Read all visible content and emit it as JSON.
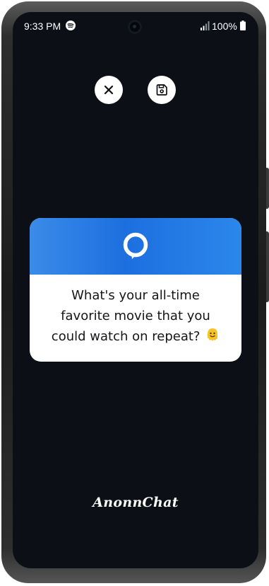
{
  "status_bar": {
    "time": "9:33 PM",
    "battery": "100%",
    "music_app_icon": "spotify-icon",
    "signal_icon": "signal-icon",
    "battery_icon": "battery-icon"
  },
  "actions": {
    "close_icon": "close-icon",
    "save_icon": "save-icon"
  },
  "card": {
    "header_icon": "chat-bubble-icon",
    "header_gradient": [
      "#3b8be8",
      "#1d6fe0",
      "#2b87ea"
    ],
    "question_line1": "What's your all-time",
    "question_line2": "favorite movie that you",
    "question_line3": "could watch on repeat?",
    "emoji": "melting-face-icon"
  },
  "brand": {
    "name": "AnonnChat"
  },
  "colors": {
    "screen_background": "#0c0f15",
    "accent_blue": "#1d6fe0",
    "card_text": "#15151a"
  }
}
